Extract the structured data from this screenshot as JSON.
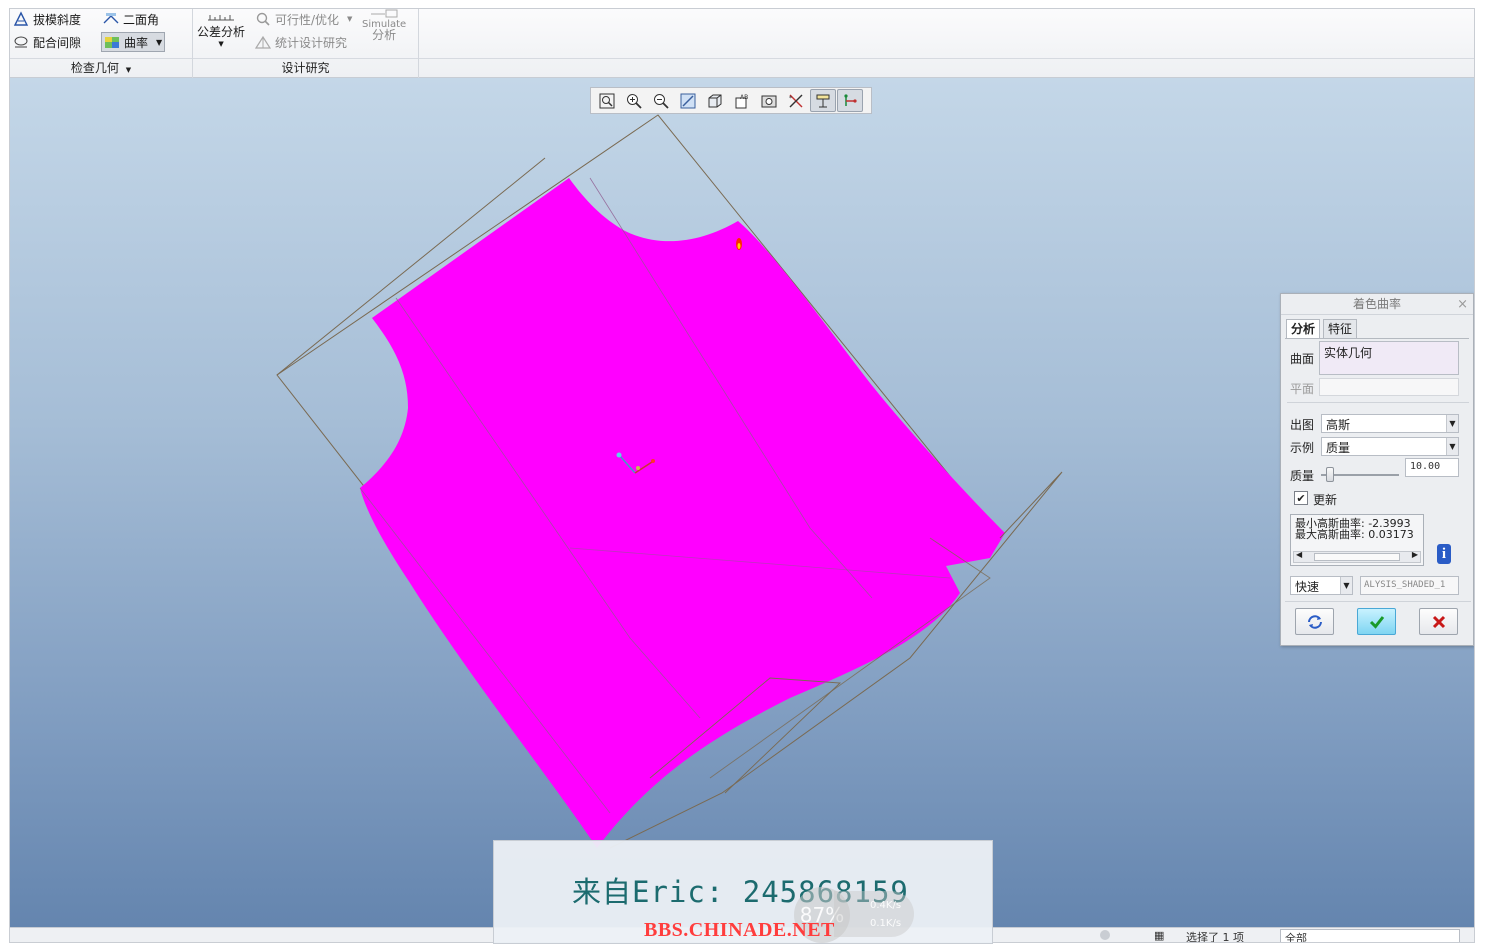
{
  "ribbon": {
    "check_geometry": {
      "draft_label": "拔模斜度",
      "dihedral_label": "二面角",
      "clearance_label": "配合间隙",
      "curvature_label": "曲率",
      "group_label": "检查几何"
    },
    "design_study": {
      "tolerance_label": "公差分析",
      "feasibility_label": "可行性/优化",
      "statistical_label": "统计设计研究",
      "simulate_label": "Simulate",
      "simulate_sub": "分析",
      "group_label": "设计研究"
    }
  },
  "view_toolbar": {
    "icons": [
      "refit-icon",
      "zoom-in-icon",
      "zoom-out-icon",
      "repaint-icon",
      "display-style-icon",
      "saved-views-icon",
      "view-manager-icon",
      "datum-display-icon",
      "annotation-display-icon",
      "spin-center-icon"
    ]
  },
  "dialog": {
    "title": "着色曲率",
    "close_glyph": "×",
    "tabs": [
      "分析",
      "特征"
    ],
    "surface_label": "曲面",
    "surface_value": "实体几何",
    "plane_label": "平面",
    "plot_label": "出图",
    "plot_value": "高斯",
    "sample_label": "示例",
    "sample_value": "质量",
    "quality_label": "质量",
    "quality_value": "10.00",
    "quality_fraction": 0.06,
    "update_label": "更新",
    "update_checked": true,
    "min_line": "最小高斯曲率: -2.3993",
    "max_line": "最大高斯曲率: 0.03173",
    "speed_value": "快速",
    "analysis_name": "ALYSIS_SHADED_1"
  },
  "watermark": {
    "text": "来自Eric: 245868159",
    "site": "BBS.CHINADE.NET",
    "gauge": "87%",
    "speed_up": "0.4K/s",
    "speed_down": "0.1K/s"
  },
  "statusbar": {
    "filter_label": "选择了 1 项",
    "filter_value": "全部"
  },
  "colors": {
    "surface": "#ff00ff",
    "wire": "#7a6a52",
    "accent": "#2a7ad6"
  }
}
